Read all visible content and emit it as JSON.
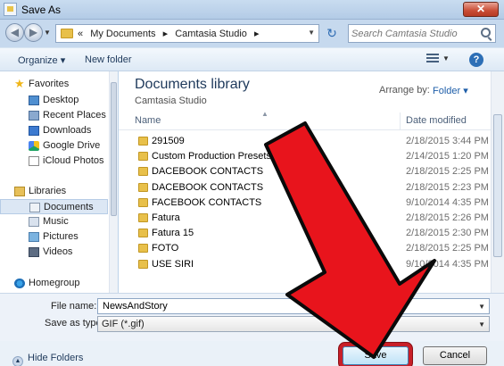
{
  "window": {
    "title": "Save As",
    "close_glyph": "✕"
  },
  "address": {
    "breadcrumbs": [
      "«",
      "My Documents",
      "▸",
      "Camtasia Studio",
      "▸"
    ],
    "search_placeholder": "Search Camtasia Studio"
  },
  "toolbar": {
    "organize": "Organize ▾",
    "new_folder": "New folder",
    "help": "?"
  },
  "nav": {
    "favorites_label": "Favorites",
    "favorites": [
      "Desktop",
      "Recent Places",
      "Downloads",
      "Google Drive",
      "iCloud Photos"
    ],
    "libraries_label": "Libraries",
    "libraries": [
      "Documents",
      "Music",
      "Pictures",
      "Videos"
    ],
    "selected": "Documents",
    "homegroup_label": "Homegroup"
  },
  "library": {
    "title": "Documents library",
    "subtitle": "Camtasia Studio",
    "arrange_by_label": "Arrange by:",
    "arrange_by_value": "Folder ▾"
  },
  "columns": {
    "name": "Name",
    "date_modified": "Date modified"
  },
  "files": [
    {
      "name": "291509",
      "date": "2/18/2015 3:44 PM"
    },
    {
      "name": "Custom Production Presets 8.0",
      "date": "2/14/2015 1:20 PM"
    },
    {
      "name": "DACEBOOK CONTACTS",
      "date": "2/18/2015 2:25 PM"
    },
    {
      "name": "DACEBOOK CONTACTS",
      "date": "2/18/2015 2:23 PM"
    },
    {
      "name": "FACEBOOK CONTACTS",
      "date": "9/10/2014 4:35 PM"
    },
    {
      "name": "Fatura",
      "date": "2/18/2015 2:26 PM"
    },
    {
      "name": "Fatura 15",
      "date": "2/18/2015 2:30 PM"
    },
    {
      "name": "FOTO",
      "date": "2/18/2015 2:25 PM"
    },
    {
      "name": "USE SIRI",
      "date": "9/10/2014 4:35 PM"
    }
  ],
  "form": {
    "file_name_label": "File name:",
    "file_name_value": "NewsAndStory",
    "save_as_type_label": "Save as type:",
    "save_as_type_value": "GIF (*.gif)"
  },
  "footer": {
    "hide_folders": "Hide Folders",
    "save": "Save",
    "cancel": "Cancel"
  },
  "colors": {
    "annotation_arrow": "#e8141c",
    "highlight_border": "#c81f28",
    "folder": "#e8c04a"
  }
}
